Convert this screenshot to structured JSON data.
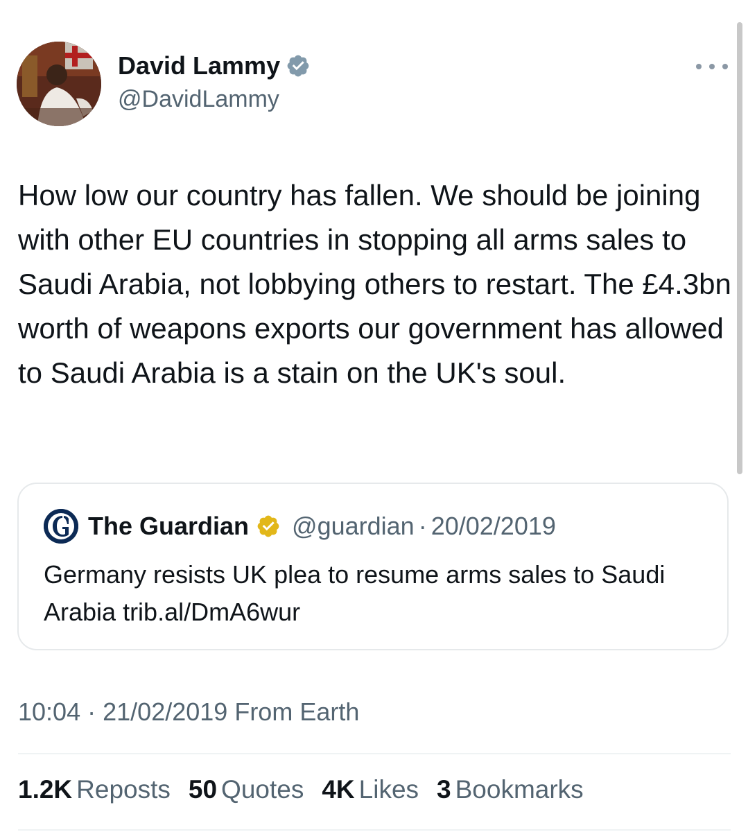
{
  "author": {
    "name": "David Lammy",
    "handle": "@DavidLammy"
  },
  "tweet": {
    "text": "How low our country has fallen. We should be joining with other EU countries in stopping all arms sales to Saudi Arabia, not lobbying others to restart. The £4.3bn worth of weapons exports our government has allowed to Saudi Arabia is a stain on the UK's soul."
  },
  "quote": {
    "name": "The Guardian",
    "handle": "@guardian",
    "separator": "·",
    "date": "20/02/2019",
    "text": "Germany resists UK plea to resume arms sales to Saudi Arabia trib.al/DmA6wur"
  },
  "meta": {
    "time": "10:04",
    "separator": "·",
    "date": "21/02/2019",
    "source": "From Earth"
  },
  "stats": [
    {
      "value": "1.2K",
      "label": "Reposts"
    },
    {
      "value": "50",
      "label": "Quotes"
    },
    {
      "value": "4K",
      "label": "Likes"
    },
    {
      "value": "3",
      "label": "Bookmarks"
    }
  ],
  "colors": {
    "text_primary": "#0f1419",
    "text_secondary": "#536471",
    "border": "#e6e9eb",
    "verified_grey": "#829aab",
    "verified_gold": "#e2b719",
    "guardian_blue": "#0c2a55"
  },
  "icons": {
    "verified_author": "verified-badge-grey",
    "verified_quote": "verified-badge-gold",
    "more": "more-horizontal-icon",
    "quote_avatar": "guardian-logo"
  }
}
